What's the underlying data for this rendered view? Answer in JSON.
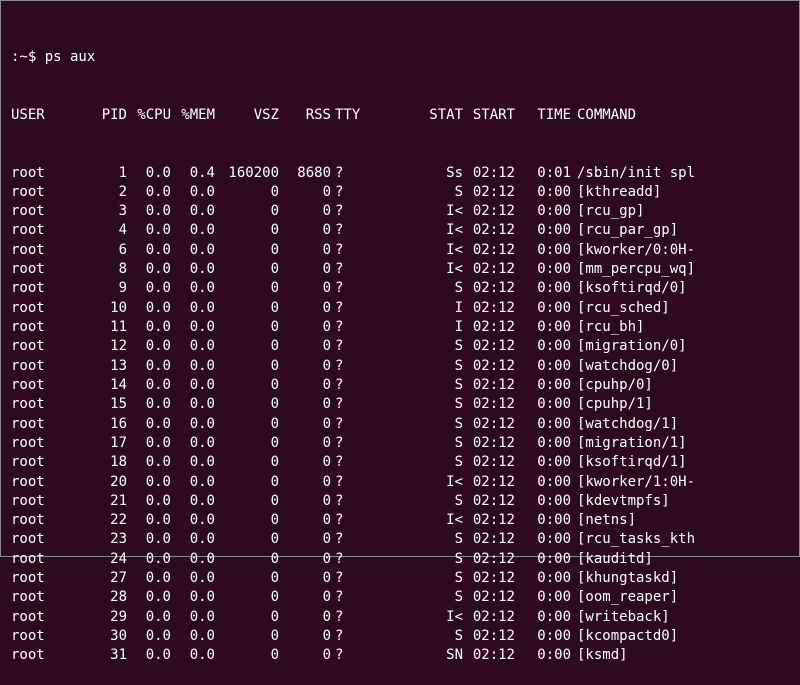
{
  "prompt": ":~$ ",
  "command": "ps aux",
  "headers": {
    "user": "USER",
    "pid": "PID",
    "cpu": "%CPU",
    "mem": "%MEM",
    "vsz": "VSZ",
    "rss": "RSS",
    "tty": "TTY",
    "stat": "STAT",
    "start": "START",
    "time": "TIME",
    "command": "COMMAND"
  },
  "processes": [
    {
      "user": "root",
      "pid": "1",
      "cpu": "0.0",
      "mem": "0.4",
      "vsz": "160200",
      "rss": "8680",
      "tty": "?",
      "stat": "Ss",
      "start": "02:12",
      "time": "0:01",
      "command": "/sbin/init spl"
    },
    {
      "user": "root",
      "pid": "2",
      "cpu": "0.0",
      "mem": "0.0",
      "vsz": "0",
      "rss": "0",
      "tty": "?",
      "stat": "S",
      "start": "02:12",
      "time": "0:00",
      "command": "[kthreadd]"
    },
    {
      "user": "root",
      "pid": "3",
      "cpu": "0.0",
      "mem": "0.0",
      "vsz": "0",
      "rss": "0",
      "tty": "?",
      "stat": "I<",
      "start": "02:12",
      "time": "0:00",
      "command": "[rcu_gp]"
    },
    {
      "user": "root",
      "pid": "4",
      "cpu": "0.0",
      "mem": "0.0",
      "vsz": "0",
      "rss": "0",
      "tty": "?",
      "stat": "I<",
      "start": "02:12",
      "time": "0:00",
      "command": "[rcu_par_gp]"
    },
    {
      "user": "root",
      "pid": "6",
      "cpu": "0.0",
      "mem": "0.0",
      "vsz": "0",
      "rss": "0",
      "tty": "?",
      "stat": "I<",
      "start": "02:12",
      "time": "0:00",
      "command": "[kworker/0:0H-"
    },
    {
      "user": "root",
      "pid": "8",
      "cpu": "0.0",
      "mem": "0.0",
      "vsz": "0",
      "rss": "0",
      "tty": "?",
      "stat": "I<",
      "start": "02:12",
      "time": "0:00",
      "command": "[mm_percpu_wq]"
    },
    {
      "user": "root",
      "pid": "9",
      "cpu": "0.0",
      "mem": "0.0",
      "vsz": "0",
      "rss": "0",
      "tty": "?",
      "stat": "S",
      "start": "02:12",
      "time": "0:00",
      "command": "[ksoftirqd/0]"
    },
    {
      "user": "root",
      "pid": "10",
      "cpu": "0.0",
      "mem": "0.0",
      "vsz": "0",
      "rss": "0",
      "tty": "?",
      "stat": "I",
      "start": "02:12",
      "time": "0:00",
      "command": "[rcu_sched]"
    },
    {
      "user": "root",
      "pid": "11",
      "cpu": "0.0",
      "mem": "0.0",
      "vsz": "0",
      "rss": "0",
      "tty": "?",
      "stat": "I",
      "start": "02:12",
      "time": "0:00",
      "command": "[rcu_bh]"
    },
    {
      "user": "root",
      "pid": "12",
      "cpu": "0.0",
      "mem": "0.0",
      "vsz": "0",
      "rss": "0",
      "tty": "?",
      "stat": "S",
      "start": "02:12",
      "time": "0:00",
      "command": "[migration/0]"
    },
    {
      "user": "root",
      "pid": "13",
      "cpu": "0.0",
      "mem": "0.0",
      "vsz": "0",
      "rss": "0",
      "tty": "?",
      "stat": "S",
      "start": "02:12",
      "time": "0:00",
      "command": "[watchdog/0]"
    },
    {
      "user": "root",
      "pid": "14",
      "cpu": "0.0",
      "mem": "0.0",
      "vsz": "0",
      "rss": "0",
      "tty": "?",
      "stat": "S",
      "start": "02:12",
      "time": "0:00",
      "command": "[cpuhp/0]"
    },
    {
      "user": "root",
      "pid": "15",
      "cpu": "0.0",
      "mem": "0.0",
      "vsz": "0",
      "rss": "0",
      "tty": "?",
      "stat": "S",
      "start": "02:12",
      "time": "0:00",
      "command": "[cpuhp/1]"
    },
    {
      "user": "root",
      "pid": "16",
      "cpu": "0.0",
      "mem": "0.0",
      "vsz": "0",
      "rss": "0",
      "tty": "?",
      "stat": "S",
      "start": "02:12",
      "time": "0:00",
      "command": "[watchdog/1]"
    },
    {
      "user": "root",
      "pid": "17",
      "cpu": "0.0",
      "mem": "0.0",
      "vsz": "0",
      "rss": "0",
      "tty": "?",
      "stat": "S",
      "start": "02:12",
      "time": "0:00",
      "command": "[migration/1]"
    },
    {
      "user": "root",
      "pid": "18",
      "cpu": "0.0",
      "mem": "0.0",
      "vsz": "0",
      "rss": "0",
      "tty": "?",
      "stat": "S",
      "start": "02:12",
      "time": "0:00",
      "command": "[ksoftirqd/1]"
    },
    {
      "user": "root",
      "pid": "20",
      "cpu": "0.0",
      "mem": "0.0",
      "vsz": "0",
      "rss": "0",
      "tty": "?",
      "stat": "I<",
      "start": "02:12",
      "time": "0:00",
      "command": "[kworker/1:0H-"
    },
    {
      "user": "root",
      "pid": "21",
      "cpu": "0.0",
      "mem": "0.0",
      "vsz": "0",
      "rss": "0",
      "tty": "?",
      "stat": "S",
      "start": "02:12",
      "time": "0:00",
      "command": "[kdevtmpfs]"
    },
    {
      "user": "root",
      "pid": "22",
      "cpu": "0.0",
      "mem": "0.0",
      "vsz": "0",
      "rss": "0",
      "tty": "?",
      "stat": "I<",
      "start": "02:12",
      "time": "0:00",
      "command": "[netns]"
    },
    {
      "user": "root",
      "pid": "23",
      "cpu": "0.0",
      "mem": "0.0",
      "vsz": "0",
      "rss": "0",
      "tty": "?",
      "stat": "S",
      "start": "02:12",
      "time": "0:00",
      "command": "[rcu_tasks_kth"
    },
    {
      "user": "root",
      "pid": "24",
      "cpu": "0.0",
      "mem": "0.0",
      "vsz": "0",
      "rss": "0",
      "tty": "?",
      "stat": "S",
      "start": "02:12",
      "time": "0:00",
      "command": "[kauditd]"
    },
    {
      "user": "root",
      "pid": "27",
      "cpu": "0.0",
      "mem": "0.0",
      "vsz": "0",
      "rss": "0",
      "tty": "?",
      "stat": "S",
      "start": "02:12",
      "time": "0:00",
      "command": "[khungtaskd]"
    },
    {
      "user": "root",
      "pid": "28",
      "cpu": "0.0",
      "mem": "0.0",
      "vsz": "0",
      "rss": "0",
      "tty": "?",
      "stat": "S",
      "start": "02:12",
      "time": "0:00",
      "command": "[oom_reaper]"
    },
    {
      "user": "root",
      "pid": "29",
      "cpu": "0.0",
      "mem": "0.0",
      "vsz": "0",
      "rss": "0",
      "tty": "?",
      "stat": "I<",
      "start": "02:12",
      "time": "0:00",
      "command": "[writeback]"
    },
    {
      "user": "root",
      "pid": "30",
      "cpu": "0.0",
      "mem": "0.0",
      "vsz": "0",
      "rss": "0",
      "tty": "?",
      "stat": "S",
      "start": "02:12",
      "time": "0:00",
      "command": "[kcompactd0]"
    },
    {
      "user": "root",
      "pid": "31",
      "cpu": "0.0",
      "mem": "0.0",
      "vsz": "0",
      "rss": "0",
      "tty": "?",
      "stat": "SN",
      "start": "02:12",
      "time": "0:00",
      "command": "[ksmd]"
    }
  ]
}
